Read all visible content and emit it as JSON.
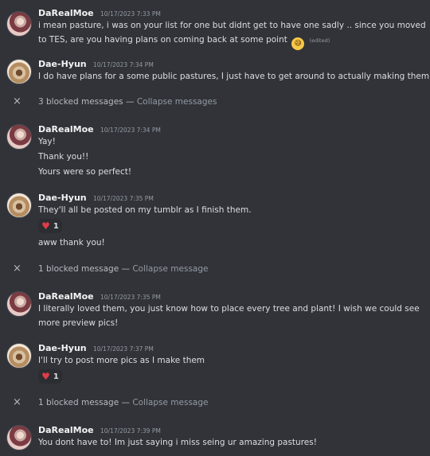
{
  "messages": [
    {
      "author": "DaRealMoe",
      "timestamp": "10/17/2023 7:33 PM",
      "lines": [
        "i mean pasture, i was on your list for one but didnt get to have one sadly .. since you moved",
        "to TES, are you having plans on coming back at some point"
      ],
      "emoji": "grinning-sweat-emoji",
      "edited": "(edited)"
    },
    {
      "author": "Dae-Hyun",
      "timestamp": "10/17/2023 7:34 PM",
      "lines": [
        "I do have plans for a some public pastures, I just have to get around to actually making them."
      ]
    },
    {
      "author": "DaRealMoe",
      "timestamp": "10/17/2023 7:34 PM",
      "lines": [
        "Yay!",
        "Thank you!!",
        "Yours were so perfect!"
      ]
    },
    {
      "author": "Dae-Hyun",
      "timestamp": "10/17/2023 7:35 PM",
      "lines": [
        "They'll all be posted on my tumblr as I finish them.",
        "aww thank you!"
      ],
      "reaction": {
        "icon": "heart-icon",
        "count": "1"
      }
    },
    {
      "author": "DaRealMoe",
      "timestamp": "10/17/2023 7:35 PM",
      "lines": [
        "I literally loved them, you just know how to place every tree and plant! I wish we could see",
        "more preview pics!"
      ]
    },
    {
      "author": "Dae-Hyun",
      "timestamp": "10/17/2023 7:37 PM",
      "lines": [
        "I'll try to post more pics as I make them"
      ],
      "reaction": {
        "icon": "heart-icon",
        "count": "1"
      }
    },
    {
      "author": "DaRealMoe",
      "timestamp": "10/17/2023 7:39 PM",
      "lines": [
        "You dont have to! Im just saying i miss seing ur amazing pastures!"
      ]
    }
  ],
  "blocked": [
    {
      "text": "3 blocked messages",
      "separator": " — ",
      "action": "Collapse messages"
    },
    {
      "text": "1 blocked message",
      "separator": " — ",
      "action": "Collapse message"
    },
    {
      "text": "1 blocked message",
      "separator": " — ",
      "action": "Collapse message"
    }
  ],
  "icons": {
    "close": "×",
    "heart": "♥",
    "emoji": "😅"
  },
  "colors": {
    "background": "#313338",
    "text": "#dbdee1",
    "muted": "#949ba4",
    "heart": "#e03c4a"
  }
}
